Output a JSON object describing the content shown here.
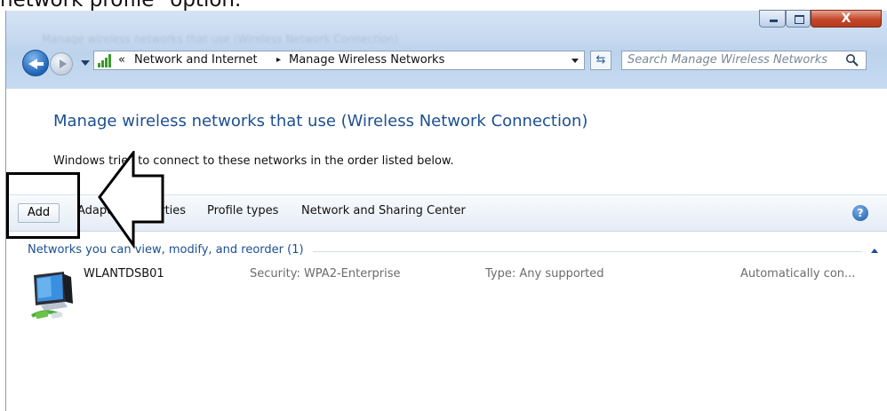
{
  "caption": "network profile\" option.",
  "window": {
    "controls": {
      "minimize_icon": "minimize-icon",
      "maximize_icon": "maximize-icon",
      "close_label": "X"
    },
    "blurred_title": "Manage wireless networks that use (Wireless Network Connection)"
  },
  "navbar": {
    "address": {
      "overflow": "«",
      "crumbs": [
        "Network and Internet",
        "Manage Wireless Networks"
      ],
      "separator": "▸"
    },
    "refresh_symbol": "⇆",
    "search": {
      "placeholder": "Search Manage Wireless Networks"
    }
  },
  "content": {
    "title": "Manage wireless networks that use (Wireless Network Connection)",
    "description": "Windows tries to connect to these networks in the order listed below."
  },
  "commandbar": {
    "add": "Add",
    "adapter_properties": "Adapter properties",
    "profile_types": "Profile types",
    "network_sharing": "Network and Sharing Center",
    "help": "?"
  },
  "network_list": {
    "group_label": "Networks you can view, modify, and reorder (1)",
    "items": [
      {
        "name": "WLANTDSB01",
        "security": "Security: WPA2-Enterprise",
        "type": "Type: Any supported",
        "mode": "Automatically con..."
      }
    ]
  },
  "colors": {
    "link_blue": "#1d4f91",
    "chrome_blue": "#c6dbf1",
    "close_red": "#c4472a"
  }
}
